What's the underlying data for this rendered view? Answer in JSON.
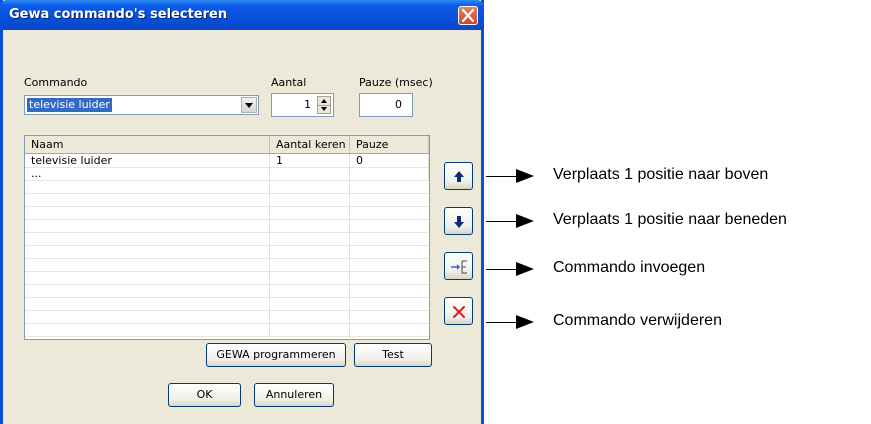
{
  "window": {
    "title": "Gewa commando's selecteren"
  },
  "commando": {
    "label": "Commando",
    "selected": "televisie luider"
  },
  "aantal": {
    "label": "Aantal",
    "value": "1"
  },
  "pauze": {
    "label": "Pauze (msec)",
    "value": "0"
  },
  "table": {
    "columns": [
      "Naam",
      "Aantal keren",
      "Pauze"
    ],
    "rows": [
      [
        "televisie luider",
        "1",
        "0"
      ],
      [
        "...",
        "",
        ""
      ]
    ]
  },
  "buttons": {
    "program": "GEWA programmeren",
    "test": "Test",
    "ok": "OK",
    "cancel": "Annuleren"
  },
  "annotations": [
    "Verplaats 1 positie naar boven",
    "Verplaats 1 positie naar beneden",
    "Commando invoegen",
    "Commando verwijderen"
  ],
  "colors": {
    "titlebar": "#0650dc",
    "window_bg": "#ece9d8",
    "side_arrow": "#0a2a7a",
    "delete_x": "#d42020",
    "selection": "#316ac5"
  }
}
